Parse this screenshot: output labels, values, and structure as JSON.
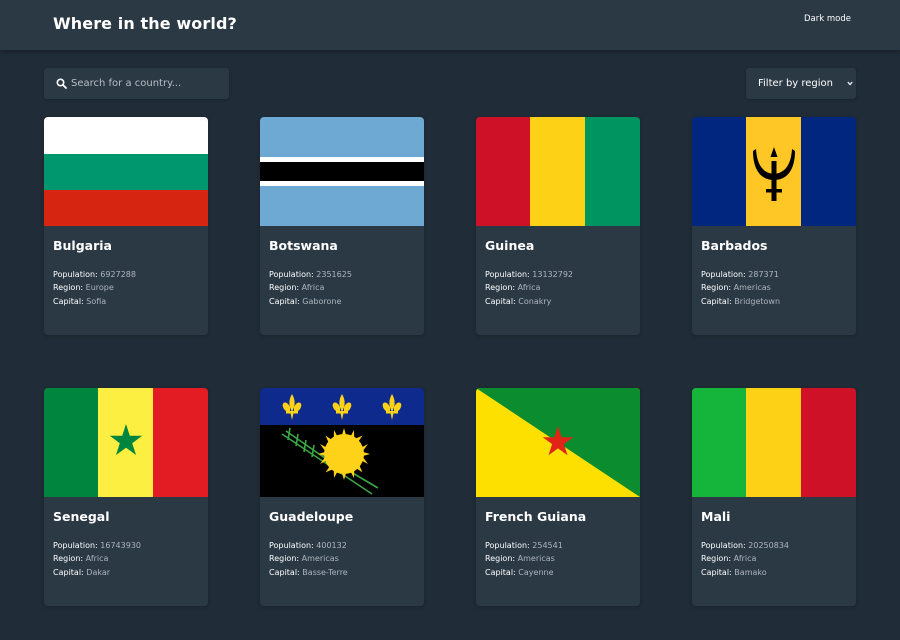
{
  "header": {
    "title": "Where in the world?",
    "dark_mode_label": "Dark mode"
  },
  "search": {
    "placeholder": "Search for a country..."
  },
  "filter": {
    "label": "Filter by region"
  },
  "labels": {
    "population": "Population:",
    "region": "Region:",
    "capital": "Capital:"
  },
  "countries": [
    {
      "name": "Bulgaria",
      "population": "6927288",
      "region": "Europe",
      "capital": "Sofia"
    },
    {
      "name": "Botswana",
      "population": "2351625",
      "region": "Africa",
      "capital": "Gaborone"
    },
    {
      "name": "Guinea",
      "population": "13132792",
      "region": "Africa",
      "capital": "Conakry"
    },
    {
      "name": "Barbados",
      "population": "287371",
      "region": "Americas",
      "capital": "Bridgetown"
    },
    {
      "name": "Senegal",
      "population": "16743930",
      "region": "Africa",
      "capital": "Dakar"
    },
    {
      "name": "Guadeloupe",
      "population": "400132",
      "region": "Americas",
      "capital": "Basse-Terre"
    },
    {
      "name": "French Guiana",
      "population": "254541",
      "region": "Americas",
      "capital": "Cayenne"
    },
    {
      "name": "Mali",
      "population": "20250834",
      "region": "Africa",
      "capital": "Bamako"
    }
  ],
  "colors": {
    "background": "#202c37",
    "elements": "#2b3945",
    "text": "#ffffff"
  }
}
